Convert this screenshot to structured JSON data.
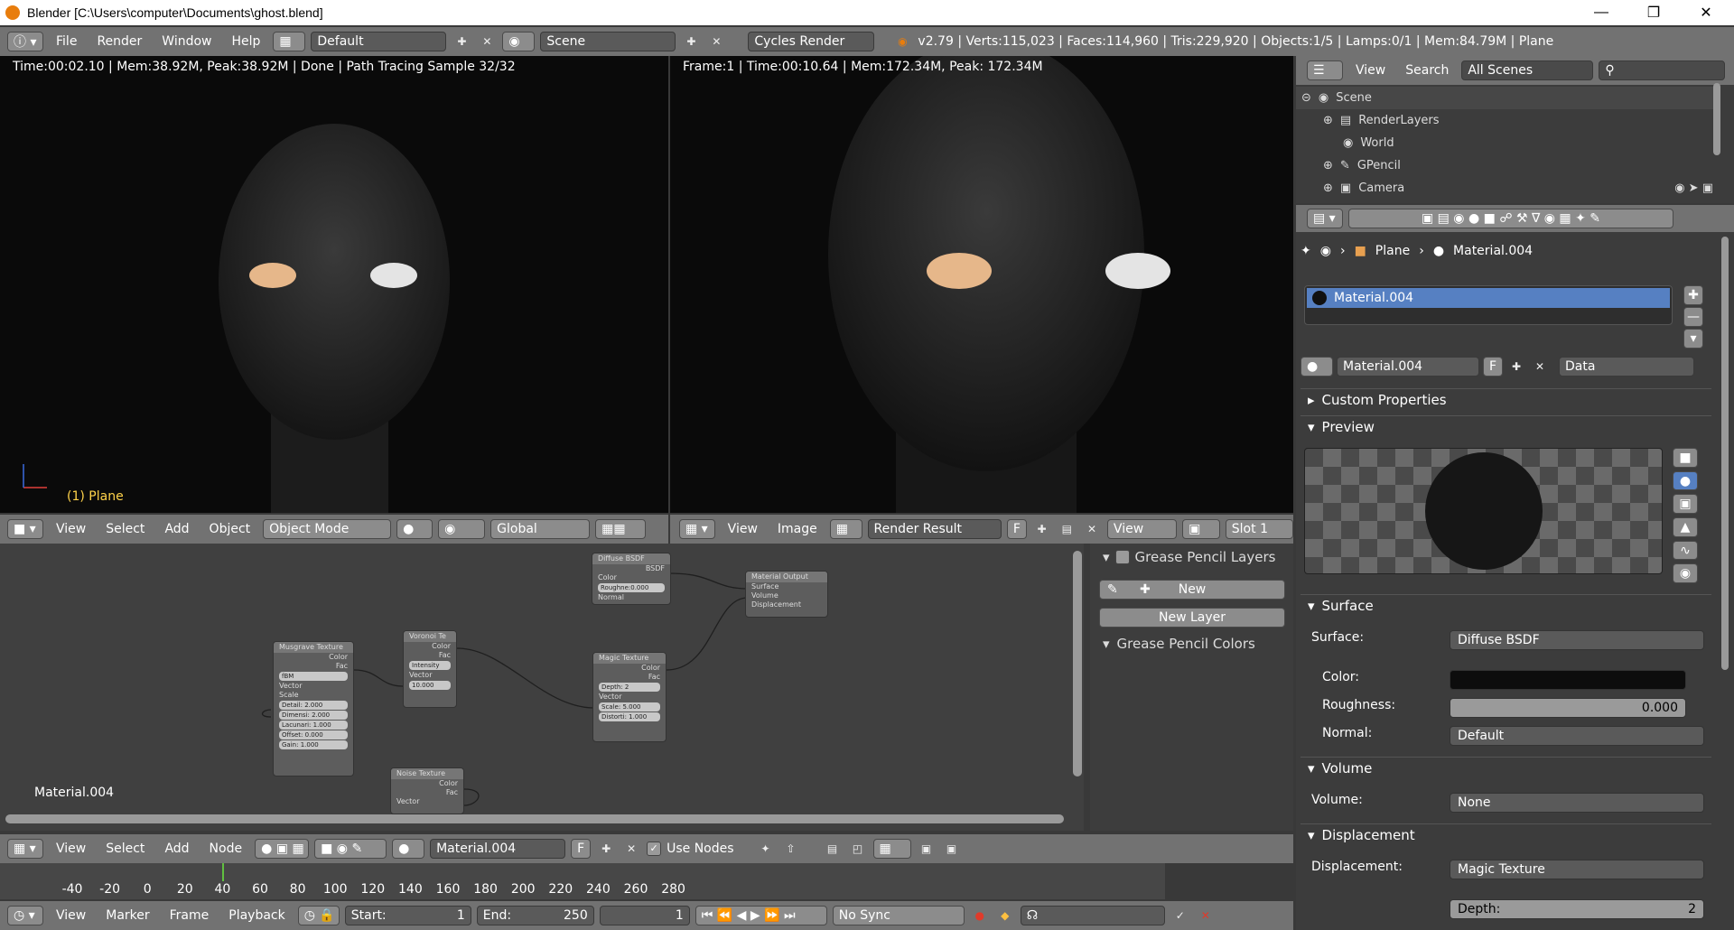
{
  "window": {
    "title": "Blender [C:\\Users\\computer\\Documents\\ghost.blend]"
  },
  "info_header": {
    "menus": [
      "File",
      "Render",
      "Window",
      "Help"
    ],
    "screen_layout": "Default",
    "scene": "Scene",
    "engine": "Cycles Render",
    "stats": "v2.79 | Verts:115,023 | Faces:114,960 | Tris:229,920 | Objects:1/5 | Lamps:0/1 | Mem:84.79M | Plane"
  },
  "viewport_left": {
    "status": "Time:00:02.10 | Mem:38.92M, Peak:38.92M | Done | Path Tracing Sample 32/32",
    "object_label": "(1) Plane",
    "header": {
      "menus": [
        "View",
        "Select",
        "Add",
        "Object"
      ],
      "mode": "Object Mode",
      "orientation": "Global"
    }
  },
  "viewport_right": {
    "status": "Frame:1 | Time:00:10.64 | Mem:172.34M, Peak: 172.34M",
    "header": {
      "menus": [
        "View",
        "Image"
      ],
      "image": "Render Result",
      "f_label": "F",
      "view": "View",
      "slot": "Slot 1"
    }
  },
  "outliner": {
    "menus": [
      "View",
      "Search"
    ],
    "scope": "All Scenes",
    "items": [
      "Scene",
      "RenderLayers",
      "World",
      "GPencil",
      "Camera"
    ]
  },
  "properties": {
    "breadcrumb": [
      "Plane",
      "Material.004"
    ],
    "slot_material": "Material.004",
    "material_name": "Material.004",
    "f_label": "F",
    "link": "Data",
    "sections": {
      "custom_properties": "Custom Properties",
      "preview": "Preview",
      "surface": "Surface",
      "volume": "Volume",
      "displacement": "Displacement"
    },
    "surface": {
      "surface_label": "Surface:",
      "surface_value": "Diffuse BSDF",
      "color_label": "Color:",
      "color_value": "#0d0d0d",
      "roughness_label": "Roughness:",
      "roughness_value": "0.000",
      "normal_label": "Normal:",
      "normal_value": "Default"
    },
    "volume": {
      "label": "Volume:",
      "value": "None"
    },
    "displacement": {
      "label": "Displacement:",
      "value": "Magic Texture",
      "depth_label": "Depth:",
      "depth_value": "2"
    }
  },
  "node_editor": {
    "material_label": "Material.004",
    "grease_pencil": {
      "layers_title": "Grease Pencil Layers",
      "new_button": "New",
      "new_layer_button": "New Layer",
      "colors_title": "Grease Pencil Colors"
    },
    "header": {
      "menus": [
        "View",
        "Select",
        "Add",
        "Node"
      ],
      "material": "Material.004",
      "f_label": "F",
      "use_nodes": "Use Nodes"
    },
    "nodes": {
      "diffuse": {
        "title": "Diffuse BSDF",
        "out": "BSDF",
        "color": "Color",
        "rough": "Roughne:0.000",
        "normal": "Normal"
      },
      "output": {
        "title": "Material Output",
        "surface": "Surface",
        "volume": "Volume",
        "disp": "Displacement"
      },
      "voronoi": {
        "title": "Voronoi Te",
        "color": "Color",
        "fac": "Fac",
        "mode": "Intensity",
        "vector": "Vector",
        "scale": "10.000"
      },
      "musgrave": {
        "title": "Musgrave Texture",
        "color": "Color",
        "fac": "Fac",
        "type": "fBM",
        "vector": "Vector",
        "scale": "Scale",
        "detail": "Detail:",
        "detail_v": "2.000",
        "dim": "Dimensi:",
        "dim_v": "2.000",
        "lac": "Lacunari:",
        "lac_v": "1.000",
        "off": "Offset:",
        "off_v": "0.000",
        "gain": "Gain:",
        "gain_v": "1.000"
      },
      "magic": {
        "title": "Magic Texture",
        "color": "Color",
        "fac": "Fac",
        "depth": "Depth:",
        "depth_v": "2",
        "vector": "Vector",
        "scale": "Scale:",
        "scale_v": "5.000",
        "dist": "Distorti:",
        "dist_v": "1.000"
      },
      "noise": {
        "title": "Noise Texture",
        "color": "Color",
        "fac": "Fac",
        "vector": "Vector"
      }
    }
  },
  "timeline": {
    "ticks": [
      "-40",
      "-20",
      "0",
      "20",
      "40",
      "60",
      "80",
      "100",
      "120",
      "140",
      "160",
      "180",
      "200",
      "220",
      "240",
      "260",
      "280"
    ],
    "menus": [
      "View",
      "Marker",
      "Frame",
      "Playback"
    ],
    "start_label": "Start:",
    "start": "1",
    "end_label": "End:",
    "end": "250",
    "current": "1",
    "sync": "No Sync"
  }
}
